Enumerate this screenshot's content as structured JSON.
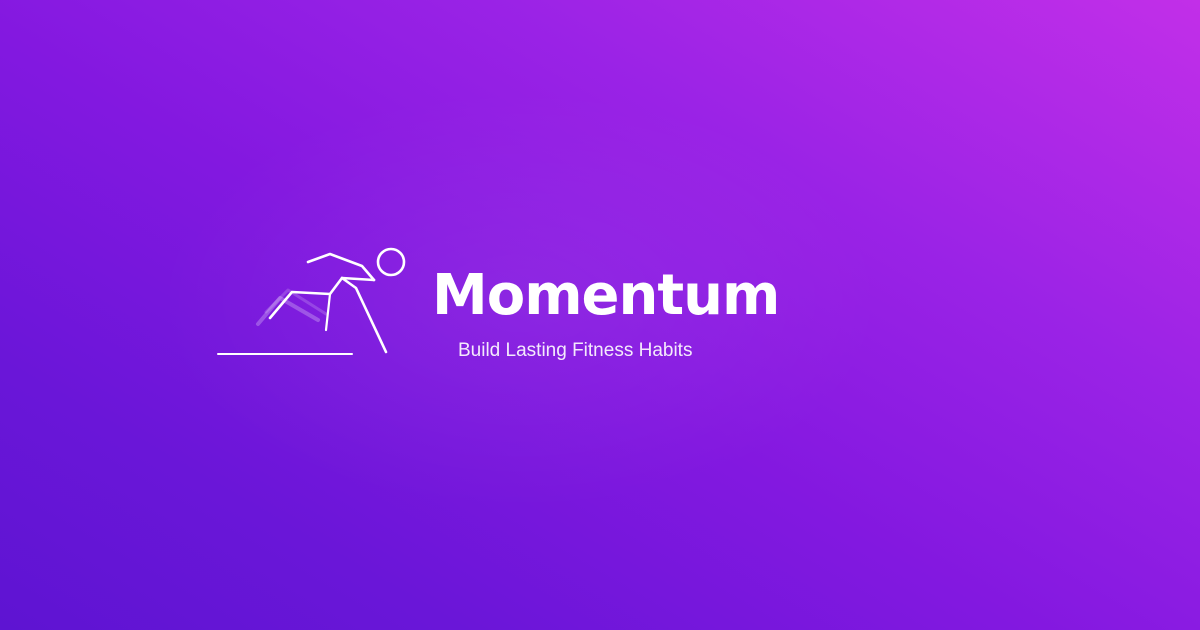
{
  "brand": {
    "name": "Momentum",
    "tagline": "Build Lasting Fitness Habits",
    "logo_icon": "sprinting-runner-icon"
  },
  "colors": {
    "background_start": "#5e14d2",
    "background_end": "#c22fe8",
    "text": "#ffffff",
    "logo_stroke": "#ffffff"
  }
}
